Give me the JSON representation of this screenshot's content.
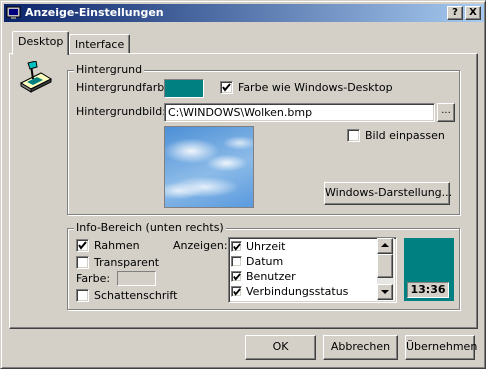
{
  "window": {
    "title": "Anzeige-Einstellungen",
    "help_label": "?",
    "close_label": "X"
  },
  "tabs": [
    {
      "label": "Desktop",
      "active": true
    },
    {
      "label": "Interface",
      "active": false
    }
  ],
  "background_group": {
    "title": "Hintergrund",
    "color_label": "Hintergrundfarbe:",
    "color_value": "#008080",
    "windows_color_checkbox": {
      "label": "Farbe wie Windows-Desktop",
      "checked": true
    },
    "image_label": "Hintergrundbild:",
    "image_path": "C:\\WINDOWS\\Wolken.bmp",
    "browse_label": "...",
    "fit_checkbox": {
      "label": "Bild einpassen",
      "checked": false
    },
    "windows_display_button": "Windows-Darstellung..."
  },
  "info_group": {
    "title": "Info-Bereich (unten rechts)",
    "frame_checkbox": {
      "label": "Rahmen",
      "checked": true
    },
    "transparent_checkbox": {
      "label": "Transparent",
      "checked": false
    },
    "color_label": "Farbe:",
    "shadow_checkbox": {
      "label": "Schattenschrift",
      "checked": false
    },
    "show_label": "Anzeigen:",
    "items": [
      {
        "label": "Uhrzeit",
        "checked": true
      },
      {
        "label": "Datum",
        "checked": false
      },
      {
        "label": "Benutzer",
        "checked": true
      },
      {
        "label": "Verbindungsstatus",
        "checked": true
      }
    ],
    "preview_time": "13:36",
    "preview_color": "#008080"
  },
  "footer": {
    "ok_label": "OK",
    "cancel_label": "Abbrechen",
    "apply_label": "Übernehmen"
  }
}
